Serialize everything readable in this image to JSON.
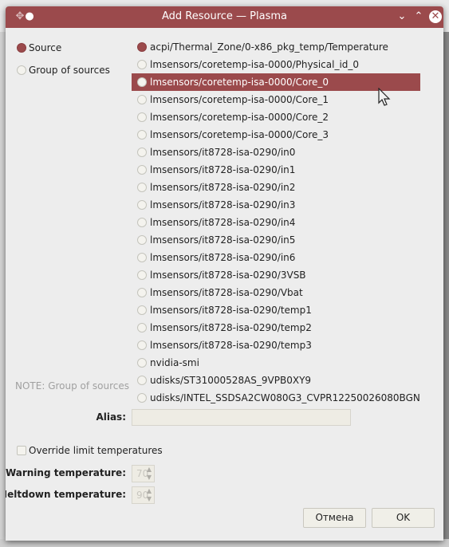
{
  "window": {
    "title": "Add Resource — Plasma",
    "accent": "#9b4a4c"
  },
  "mode": {
    "source_label": "Source",
    "group_label": "Group of sources",
    "selected": "source"
  },
  "sources": [
    {
      "label": "acpi/Thermal_Zone/0-x86_pkg_temp/Temperature",
      "checked": true
    },
    {
      "label": "lmsensors/coretemp-isa-0000/Physical_id_0"
    },
    {
      "label": "lmsensors/coretemp-isa-0000/Core_0",
      "highlighted": true
    },
    {
      "label": "lmsensors/coretemp-isa-0000/Core_1"
    },
    {
      "label": "lmsensors/coretemp-isa-0000/Core_2"
    },
    {
      "label": "lmsensors/coretemp-isa-0000/Core_3"
    },
    {
      "label": "lmsensors/it8728-isa-0290/in0"
    },
    {
      "label": "lmsensors/it8728-isa-0290/in1"
    },
    {
      "label": "lmsensors/it8728-isa-0290/in2"
    },
    {
      "label": "lmsensors/it8728-isa-0290/in3"
    },
    {
      "label": "lmsensors/it8728-isa-0290/in4"
    },
    {
      "label": "lmsensors/it8728-isa-0290/in5"
    },
    {
      "label": "lmsensors/it8728-isa-0290/in6"
    },
    {
      "label": "lmsensors/it8728-isa-0290/3VSB"
    },
    {
      "label": "lmsensors/it8728-isa-0290/Vbat"
    },
    {
      "label": "lmsensors/it8728-isa-0290/temp1"
    },
    {
      "label": "lmsensors/it8728-isa-0290/temp2"
    },
    {
      "label": "lmsensors/it8728-isa-0290/temp3"
    },
    {
      "label": "nvidia-smi"
    },
    {
      "label": "udisks/ST31000528AS_9VPB0XY9"
    },
    {
      "label": "udisks/INTEL_SSDSA2CW080G3_CVPR12250026080BGN"
    }
  ],
  "note": "NOTE: Group of sources shows max temperature",
  "alias": {
    "label": "Alias:",
    "value": ""
  },
  "override": {
    "label": "Override limit temperatures",
    "checked": false
  },
  "warning": {
    "label": "Warning temperature:",
    "value": "70"
  },
  "meltdown": {
    "label": "Meltdown temperature:",
    "value": "90"
  },
  "buttons": {
    "cancel": "Отмена",
    "ok": "OK"
  }
}
